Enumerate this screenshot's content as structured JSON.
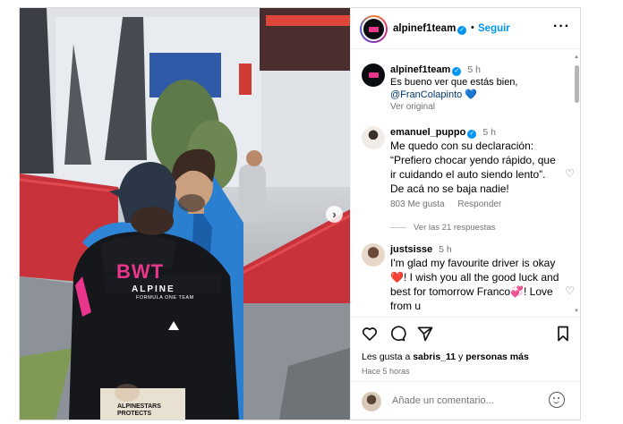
{
  "post": {
    "photo": {
      "jacket_brand": "BWT",
      "jacket_team": "ALPINE",
      "jacket_sub": "FORMULA ONE TEAM",
      "jacket_sponsor": "ALPINESTARS",
      "jacket_sponsor2": "PROTECTS",
      "next_icon": "chevron-right-icon"
    },
    "header": {
      "username": "alpinef1team",
      "separator": "•",
      "follow_label": "Seguir",
      "more_icon": "more-horizontal-icon"
    },
    "comments": [
      {
        "username": "alpinef1team",
        "time": "5 h",
        "text": "Es bueno ver que estás bien,",
        "mention": "@FranColapinto",
        "emoji": "💙",
        "meta": "Ver original"
      },
      {
        "username": "emanuel_puppo",
        "time": "5 h",
        "text": "Me quedo con su declaración: “Prefiero chocar yendo rápido, que ir cuidando el auto siendo lento”. De acá no se baja nadie!",
        "likes": "803 Me gusta",
        "reply": "Responder",
        "replies": "Ver las 21 respuestas"
      },
      {
        "username": "justsisse",
        "time": "5 h",
        "text": "I'm glad my favourite driver is okay❤️! I wish you all the good luck and best for tomorrow Franco💞! Love from u"
      }
    ],
    "actions": {
      "likes_prefix": "Les gusta a ",
      "likes_user": "sabris_11",
      "likes_mid": " y ",
      "likes_others": "personas más",
      "time_ago": "Hace 5 horas"
    },
    "add_comment": {
      "placeholder": "Añade un comentario..."
    }
  }
}
